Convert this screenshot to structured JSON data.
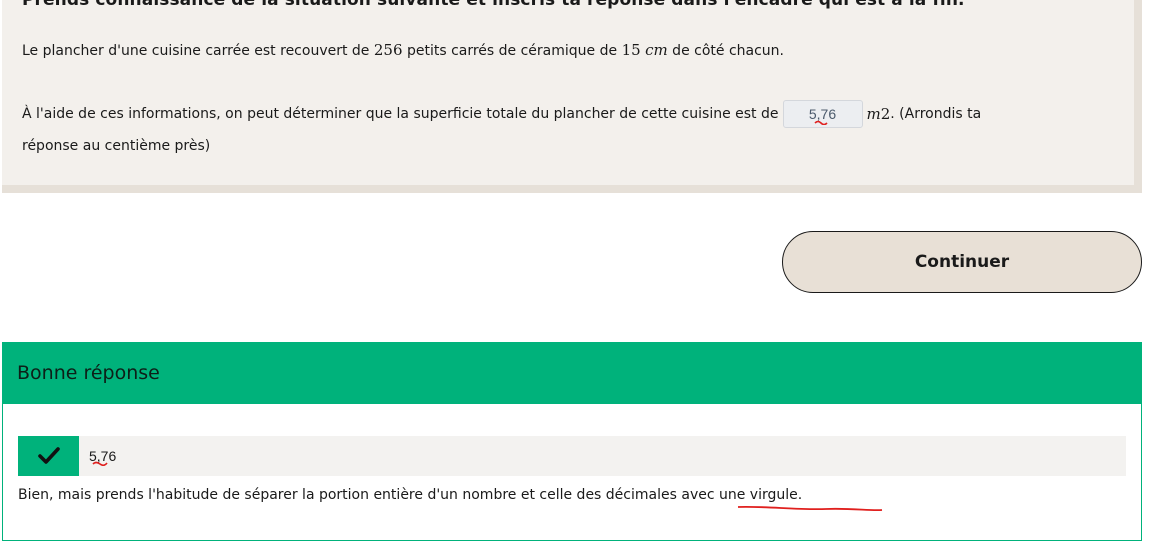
{
  "question": {
    "title": "Prends connaissance de la situation suivante et inscris ta réponse dans l'encadré qui est à la fin.",
    "line1_prefix": "Le plancher d'une cuisine carrée est recouvert de ",
    "tile_count": "256",
    "line1_middle": " petits carrés de céramique de ",
    "tile_side": "15",
    "tile_unit": "cm",
    "line1_suffix": " de côté chacun.",
    "line2_prefix": "À l'aide de ces informations, on peut déterminer que la superficie totale du plancher de cette cuisine est de",
    "answer_value": "5,76",
    "area_unit": "m",
    "area_exponent": "2",
    "line2_suffix": ". (Arrondis ta",
    "line3": "réponse au centième près)"
  },
  "continue_button": {
    "label": "Continuer"
  },
  "feedback": {
    "header": "Bonne réponse",
    "submitted_answer": "5,76",
    "message_prefix": "Bien, mais prends l'habitude de séparer la portion entière d'un nombre et celle des décimales ",
    "message_emphasis": "avec une virgule",
    "message_suffix": ".",
    "colors": {
      "success": "#00b27b",
      "spellcheck": "#e0201e"
    }
  }
}
